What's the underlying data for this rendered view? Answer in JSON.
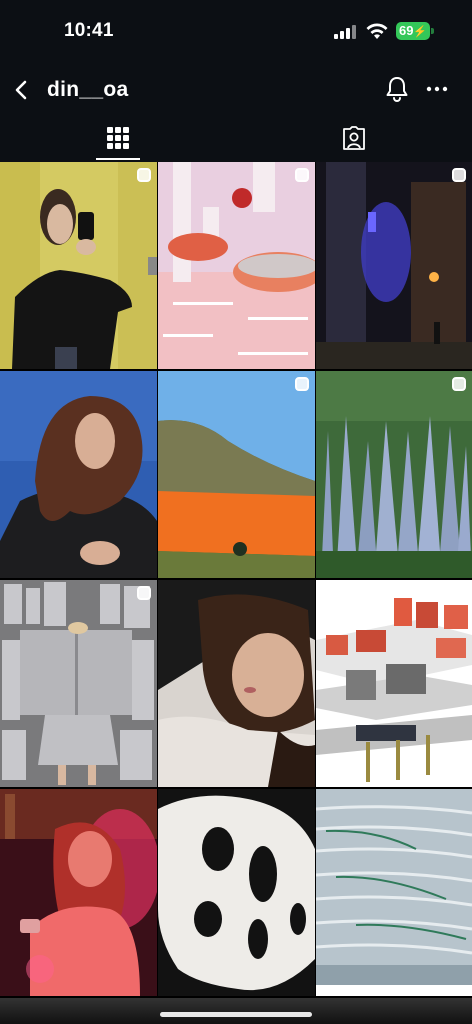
{
  "status_bar": {
    "time": "10:41",
    "battery": "69"
  },
  "header": {
    "username": "din__oa"
  },
  "tabs": [
    {
      "name": "grid",
      "selected": true
    },
    {
      "name": "tagged",
      "selected": false
    }
  ],
  "icons": {
    "back": "chevron-left-icon",
    "notifications": "bell-icon",
    "more": "more-horizontal-icon",
    "grid": "grid-icon",
    "tagged": "person-tag-icon",
    "multi": "multiple-images-icon"
  },
  "colors": {
    "background": "#000000",
    "header": "#0c0f14",
    "battery": "#34c759"
  },
  "posts": [
    {
      "subject": "mirror selfie in yellow room",
      "multiple": true
    },
    {
      "subject": "pink room with red spotted mushroom art",
      "multiple": true
    },
    {
      "subject": "night stone street with blue light",
      "multiple": true
    },
    {
      "subject": "woman with hair blowing against blue sky",
      "multiple": false
    },
    {
      "subject": "orange curtain across mountain valley",
      "multiple": true
    },
    {
      "subject": "grey limestone pinnacles forest",
      "multiple": true
    },
    {
      "subject": "person holding foil book among silver books",
      "multiple": true
    },
    {
      "subject": "woman lying close-up portrait",
      "multiple": false
    },
    {
      "subject": "industrial architecture render",
      "multiple": false
    },
    {
      "subject": "woman in red light with phone",
      "multiple": false
    },
    {
      "subject": "white organic sculpture",
      "multiple": false
    },
    {
      "subject": "ocean wave pattern aerial",
      "multiple": false
    }
  ]
}
